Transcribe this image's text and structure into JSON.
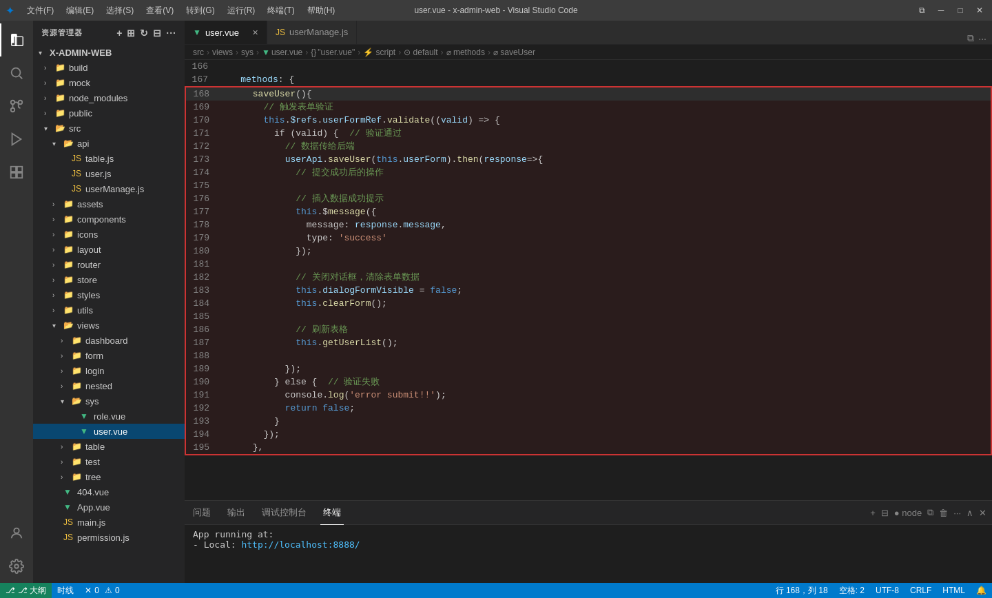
{
  "titlebar": {
    "menu_items": [
      "文件(F)",
      "编辑(E)",
      "选择(S)",
      "查看(V)",
      "转到(G)",
      "运行(R)",
      "终端(T)",
      "帮助(H)"
    ],
    "title": "user.vue - x-admin-web - Visual Studio Code",
    "controls": [
      "⧉",
      "─",
      "□",
      "✕"
    ]
  },
  "sidebar": {
    "header": "资源管理器",
    "root": "X-ADMIN-WEB",
    "items": [
      {
        "id": "build",
        "label": "build",
        "indent": 1,
        "type": "folder",
        "expanded": false
      },
      {
        "id": "mock",
        "label": "mock",
        "indent": 1,
        "type": "folder",
        "expanded": false
      },
      {
        "id": "node_modules",
        "label": "node_modules",
        "indent": 1,
        "type": "folder",
        "expanded": false
      },
      {
        "id": "public",
        "label": "public",
        "indent": 1,
        "type": "folder",
        "expanded": false
      },
      {
        "id": "src",
        "label": "src",
        "indent": 1,
        "type": "folder",
        "expanded": true
      },
      {
        "id": "api",
        "label": "api",
        "indent": 2,
        "type": "folder",
        "expanded": true
      },
      {
        "id": "table.js",
        "label": "table.js",
        "indent": 3,
        "type": "js"
      },
      {
        "id": "user.js",
        "label": "user.js",
        "indent": 3,
        "type": "js"
      },
      {
        "id": "userManage.js",
        "label": "userManage.js",
        "indent": 3,
        "type": "js"
      },
      {
        "id": "assets",
        "label": "assets",
        "indent": 2,
        "type": "folder",
        "expanded": false
      },
      {
        "id": "components",
        "label": "components",
        "indent": 2,
        "type": "folder",
        "expanded": false
      },
      {
        "id": "icons",
        "label": "icons",
        "indent": 2,
        "type": "folder",
        "expanded": false
      },
      {
        "id": "layout",
        "label": "layout",
        "indent": 2,
        "type": "folder",
        "expanded": false
      },
      {
        "id": "router",
        "label": "router",
        "indent": 2,
        "type": "folder",
        "expanded": false
      },
      {
        "id": "store",
        "label": "store",
        "indent": 2,
        "type": "folder",
        "expanded": false
      },
      {
        "id": "styles",
        "label": "styles",
        "indent": 2,
        "type": "folder",
        "expanded": false
      },
      {
        "id": "utils",
        "label": "utils",
        "indent": 2,
        "type": "folder",
        "expanded": false
      },
      {
        "id": "views",
        "label": "views",
        "indent": 2,
        "type": "folder",
        "expanded": true
      },
      {
        "id": "dashboard",
        "label": "dashboard",
        "indent": 3,
        "type": "folder",
        "expanded": false
      },
      {
        "id": "form",
        "label": "form",
        "indent": 3,
        "type": "folder",
        "expanded": false
      },
      {
        "id": "login",
        "label": "login",
        "indent": 3,
        "type": "folder",
        "expanded": false
      },
      {
        "id": "nested",
        "label": "nested",
        "indent": 3,
        "type": "folder",
        "expanded": false
      },
      {
        "id": "sys",
        "label": "sys",
        "indent": 3,
        "type": "folder",
        "expanded": true
      },
      {
        "id": "role.vue",
        "label": "role.vue",
        "indent": 4,
        "type": "vue"
      },
      {
        "id": "user.vue",
        "label": "user.vue",
        "indent": 4,
        "type": "vue",
        "active": true
      },
      {
        "id": "table",
        "label": "table",
        "indent": 3,
        "type": "folder",
        "expanded": false
      },
      {
        "id": "test",
        "label": "test",
        "indent": 3,
        "type": "folder",
        "expanded": false
      },
      {
        "id": "tree",
        "label": "tree",
        "indent": 3,
        "type": "folder",
        "expanded": false
      },
      {
        "id": "404.vue",
        "label": "404.vue",
        "indent": 2,
        "type": "vue"
      },
      {
        "id": "App.vue",
        "label": "App.vue",
        "indent": 2,
        "type": "vue"
      },
      {
        "id": "main.js",
        "label": "main.js",
        "indent": 2,
        "type": "js"
      },
      {
        "id": "permission.js",
        "label": "permission.js",
        "indent": 2,
        "type": "js"
      }
    ]
  },
  "tabs": [
    {
      "label": "user.vue",
      "type": "vue",
      "active": true
    },
    {
      "label": "userManage.js",
      "type": "js",
      "active": false
    }
  ],
  "breadcrumb": {
    "parts": [
      "src",
      ">",
      "views",
      ">",
      "sys",
      ">",
      "user.vue",
      ">",
      "{}",
      "\"user.vue\"",
      ">",
      "script",
      ">",
      "default",
      ">",
      "methods",
      ">",
      "saveUser"
    ]
  },
  "code_lines": [
    {
      "num": 166,
      "content": "",
      "highlighted": false
    },
    {
      "num": 167,
      "content": "    methods: {",
      "highlighted": false
    },
    {
      "num": 168,
      "content": "      saveUser(){",
      "highlighted": true,
      "current": true
    },
    {
      "num": 169,
      "content": "        // 触发表单验证",
      "highlighted": true
    },
    {
      "num": 170,
      "content": "        this.$refs.userFormRef.validate((valid) => {",
      "highlighted": true
    },
    {
      "num": 171,
      "content": "          if (valid) {  // 验证通过",
      "highlighted": true
    },
    {
      "num": 172,
      "content": "            // 数据传给后端",
      "highlighted": true
    },
    {
      "num": 173,
      "content": "            userApi.saveUser(this.userForm).then(response=>{",
      "highlighted": true
    },
    {
      "num": 174,
      "content": "              // 提交成功后的操作",
      "highlighted": true
    },
    {
      "num": 175,
      "content": "",
      "highlighted": true
    },
    {
      "num": 176,
      "content": "              // 插入数据成功提示",
      "highlighted": true
    },
    {
      "num": 177,
      "content": "              this.$message({",
      "highlighted": true
    },
    {
      "num": 178,
      "content": "                message: response.message,",
      "highlighted": true
    },
    {
      "num": 179,
      "content": "                type: 'success'",
      "highlighted": true
    },
    {
      "num": 180,
      "content": "              });",
      "highlighted": true
    },
    {
      "num": 181,
      "content": "",
      "highlighted": true
    },
    {
      "num": 182,
      "content": "              // 关闭对话框，清除表单数据",
      "highlighted": true
    },
    {
      "num": 183,
      "content": "              this.dialogFormVisible = false;",
      "highlighted": true
    },
    {
      "num": 184,
      "content": "              this.clearForm();",
      "highlighted": true
    },
    {
      "num": 185,
      "content": "",
      "highlighted": true
    },
    {
      "num": 186,
      "content": "              // 刷新表格",
      "highlighted": true
    },
    {
      "num": 187,
      "content": "              this.getUserList();",
      "highlighted": true
    },
    {
      "num": 188,
      "content": "",
      "highlighted": true
    },
    {
      "num": 189,
      "content": "            });",
      "highlighted": true
    },
    {
      "num": 190,
      "content": "          } else {  // 验证失败",
      "highlighted": true
    },
    {
      "num": 191,
      "content": "            console.log('error submit!!');",
      "highlighted": true
    },
    {
      "num": 192,
      "content": "            return false;",
      "highlighted": true
    },
    {
      "num": 193,
      "content": "          }",
      "highlighted": true
    },
    {
      "num": 194,
      "content": "        });",
      "highlighted": true
    },
    {
      "num": 195,
      "content": "      },",
      "highlighted": true
    }
  ],
  "panel": {
    "tabs": [
      "问题",
      "输出",
      "调试控制台",
      "终端"
    ],
    "active_tab": "终端",
    "content_line1": "App running at:",
    "content_line2": "  - Local:    http://localhost:8888/"
  },
  "statusbar": {
    "remote": "⎇ 大纲",
    "branch": "时线",
    "errors": "0",
    "warnings": "0",
    "position": "行 168，列 18",
    "spaces": "空格: 2",
    "encoding": "UTF-8",
    "line_ending": "CRLF",
    "language": "HTML"
  }
}
